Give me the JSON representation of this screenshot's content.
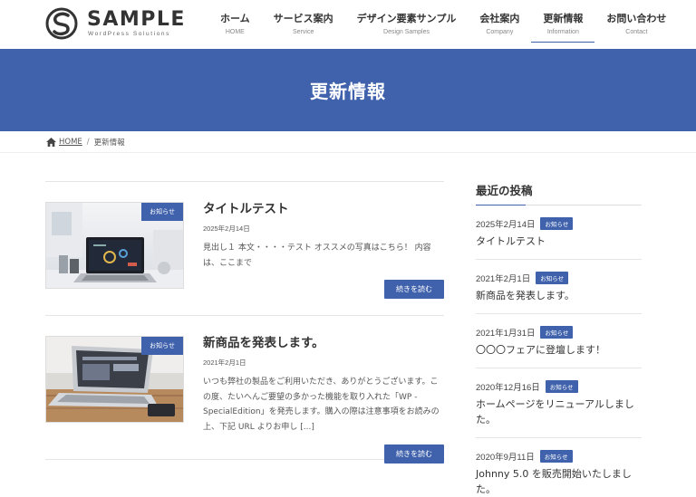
{
  "header": {
    "logo_title": "SAMPLE",
    "logo_subtitle": "WordPress Solutions",
    "nav": [
      {
        "jp": "ホーム",
        "en": "HOME"
      },
      {
        "jp": "サービス案内",
        "en": "Service"
      },
      {
        "jp": "デザイン要素サンプル",
        "en": "Design Samples"
      },
      {
        "jp": "会社案内",
        "en": "Company"
      },
      {
        "jp": "更新情報",
        "en": "Information"
      },
      {
        "jp": "お問い合わせ",
        "en": "Contact"
      }
    ]
  },
  "hero": {
    "title": "更新情報"
  },
  "breadcrumb": {
    "home": "HOME",
    "separator": "/",
    "current": "更新情報"
  },
  "posts": [
    {
      "category": "お知らせ",
      "title": "タイトルテスト",
      "date": "2025年2月14日",
      "excerpt": "見出し１ 本文・・・・テスト オススメの写真はこちら！ 内容は、ここまで",
      "read_more": "続きを読む"
    },
    {
      "category": "お知らせ",
      "title": "新商品を発表します。",
      "date": "2021年2月1日",
      "excerpt": "いつも弊社の製品をご利用いただき、ありがとうございます。この度、たいへんご要望の多かった機能を取り入れた「WP - SpecialEdition」を発売します。購入の際は注意事項をお読みの上、下記 URL よりお申し [...]",
      "read_more": "続きを読む"
    }
  ],
  "sidebar": {
    "heading": "最近の投稿",
    "items": [
      {
        "date": "2025年2月14日",
        "badge": "お知らせ",
        "title": "タイトルテスト"
      },
      {
        "date": "2021年2月1日",
        "badge": "お知らせ",
        "title": "新商品を発表します。"
      },
      {
        "date": "2021年1月31日",
        "badge": "お知らせ",
        "title": "〇〇〇フェアに登壇します！"
      },
      {
        "date": "2020年12月16日",
        "badge": "お知らせ",
        "title": "ホームページをリニューアルしました。"
      },
      {
        "date": "2020年9月11日",
        "badge": "お知らせ",
        "title": "Johnny 5.0 を販売開始いたしました。"
      }
    ]
  },
  "colors": {
    "accent": "#4062ac",
    "text": "#333333",
    "border": "#e5e5e5"
  }
}
